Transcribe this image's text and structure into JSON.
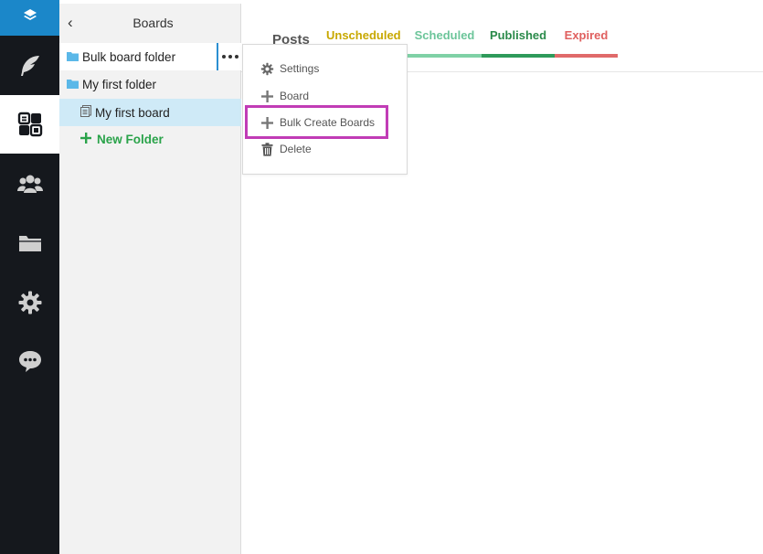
{
  "rail": {
    "logo_icon": "layers-icon",
    "items": [
      {
        "name": "feather-icon",
        "active": false
      },
      {
        "name": "boards-icon",
        "active": true
      },
      {
        "name": "team-icon",
        "active": false
      },
      {
        "name": "folder-icon",
        "active": false
      },
      {
        "name": "settings-gear-icon",
        "active": false
      },
      {
        "name": "chat-icon",
        "active": false
      }
    ]
  },
  "panel": {
    "back_glyph": "‹",
    "title": "Boards",
    "tree": [
      {
        "label": "Bulk board folder",
        "type": "folder"
      },
      {
        "label": "My first folder",
        "type": "folder"
      },
      {
        "label": "My first board",
        "type": "board"
      }
    ],
    "new_folder_label": "New Folder"
  },
  "main": {
    "posts_label": "Posts",
    "tabs": [
      {
        "label": "Unscheduled",
        "color": "#c8a800",
        "bar_color": "#f5f0a8"
      },
      {
        "label": "Scheduled",
        "color": "#6cc59a",
        "bar_color": "#7fd1a6"
      },
      {
        "label": "Published",
        "color": "#2a8a4a",
        "bar_color": "#2e9a5a"
      },
      {
        "label": "Expired",
        "color": "#e0605f",
        "bar_color": "#e06a6a"
      }
    ]
  },
  "menu": {
    "items": [
      {
        "label": "Settings",
        "icon": "gear-icon"
      },
      {
        "label": "Board",
        "icon": "plus-icon"
      },
      {
        "label": "Bulk Create Boards",
        "icon": "plus-icon"
      },
      {
        "label": "Delete",
        "icon": "trash-icon"
      }
    ]
  },
  "colors": {
    "rail_bg": "#15181d",
    "logo_bg": "#1b87c9",
    "highlight": "#c13cb6",
    "selected_board_bg": "#cfeaf7",
    "folder_icon": "#5bb8e8",
    "new_folder": "#2aa34a"
  }
}
